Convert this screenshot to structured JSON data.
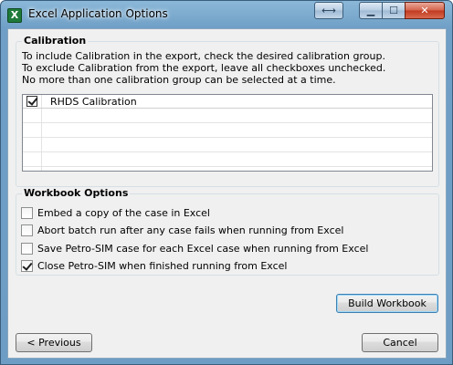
{
  "window": {
    "title": "Excel Application Options",
    "app_icon_glyph": "X",
    "controls": {
      "resize_glyph": "⟷",
      "minimize_glyph": "▁",
      "maximize_glyph": "☐",
      "close_glyph": "✕"
    }
  },
  "calibration": {
    "title": "Calibration",
    "instructions": [
      "To include Calibration in the export, check the desired calibration group.",
      "To exclude Calibration from the export, leave all checkboxes unchecked.",
      "No more than one calibration group can be selected at a time."
    ],
    "groups": [
      {
        "label": "RHDS Calibration",
        "checked": true
      }
    ]
  },
  "workbook_options": {
    "title": "Workbook Options",
    "options": [
      {
        "label": "Embed a copy of the case in Excel",
        "checked": false
      },
      {
        "label": "Abort batch run after any case fails when running from Excel",
        "checked": false
      },
      {
        "label": "Save Petro-SIM case for each Excel case when running from Excel",
        "checked": false
      },
      {
        "label": "Close Petro-SIM when finished running from Excel",
        "checked": true
      }
    ]
  },
  "buttons": {
    "build_workbook": "Build Workbook",
    "previous": "< Previous",
    "cancel": "Cancel"
  }
}
